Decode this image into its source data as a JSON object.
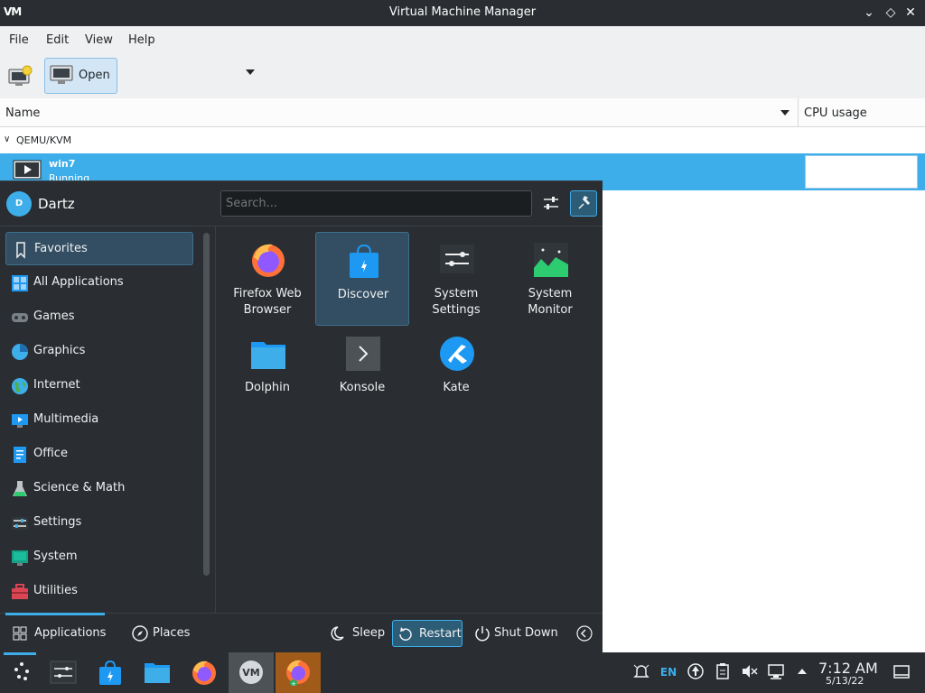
{
  "window": {
    "title": "Virtual Machine Manager",
    "logo_text": "VM",
    "controls": [
      "minimize",
      "maximize",
      "close"
    ]
  },
  "menubar": {
    "items": [
      "File",
      "Edit",
      "View",
      "Help"
    ]
  },
  "toolbar": {
    "open_label": "Open"
  },
  "list": {
    "col_name": "Name",
    "col_cpu": "CPU usage",
    "group": "QEMU/KVM",
    "vm": {
      "name": "win7",
      "status": "Running"
    }
  },
  "kickoff": {
    "user_initial": "D",
    "user_name": "Dartz",
    "search_placeholder": "Search...",
    "categories": [
      {
        "label": "Favorites",
        "icon": "bookmark-icon"
      },
      {
        "label": "All Applications",
        "icon": "grid-icon"
      },
      {
        "label": "Games",
        "icon": "gamepad-icon"
      },
      {
        "label": "Graphics",
        "icon": "graphics-icon"
      },
      {
        "label": "Internet",
        "icon": "globe-icon"
      },
      {
        "label": "Multimedia",
        "icon": "multimedia-icon"
      },
      {
        "label": "Office",
        "icon": "office-icon"
      },
      {
        "label": "Science & Math",
        "icon": "flask-icon"
      },
      {
        "label": "Settings",
        "icon": "sliders-icon"
      },
      {
        "label": "System",
        "icon": "system-icon"
      },
      {
        "label": "Utilities",
        "icon": "toolbox-icon"
      }
    ],
    "apps": [
      {
        "line1": "Firefox Web",
        "line2": "Browser"
      },
      {
        "line1": "Discover",
        "line2": ""
      },
      {
        "line1": "System",
        "line2": "Settings"
      },
      {
        "line1": "System",
        "line2": "Monitor"
      },
      {
        "line1": "Dolphin",
        "line2": ""
      },
      {
        "line1": "Konsole",
        "line2": ""
      },
      {
        "line1": "Kate",
        "line2": ""
      }
    ],
    "footer": {
      "applications": "Applications",
      "places": "Places",
      "sleep": "Sleep",
      "restart": "Restart",
      "shutdown": "Shut Down"
    }
  },
  "taskbar": {
    "lang": "EN",
    "time": "7:12 AM",
    "date": "5/13/22"
  },
  "colors": {
    "accent": "#3daee9",
    "panel": "#2a2e32",
    "selection": "#334e62"
  }
}
